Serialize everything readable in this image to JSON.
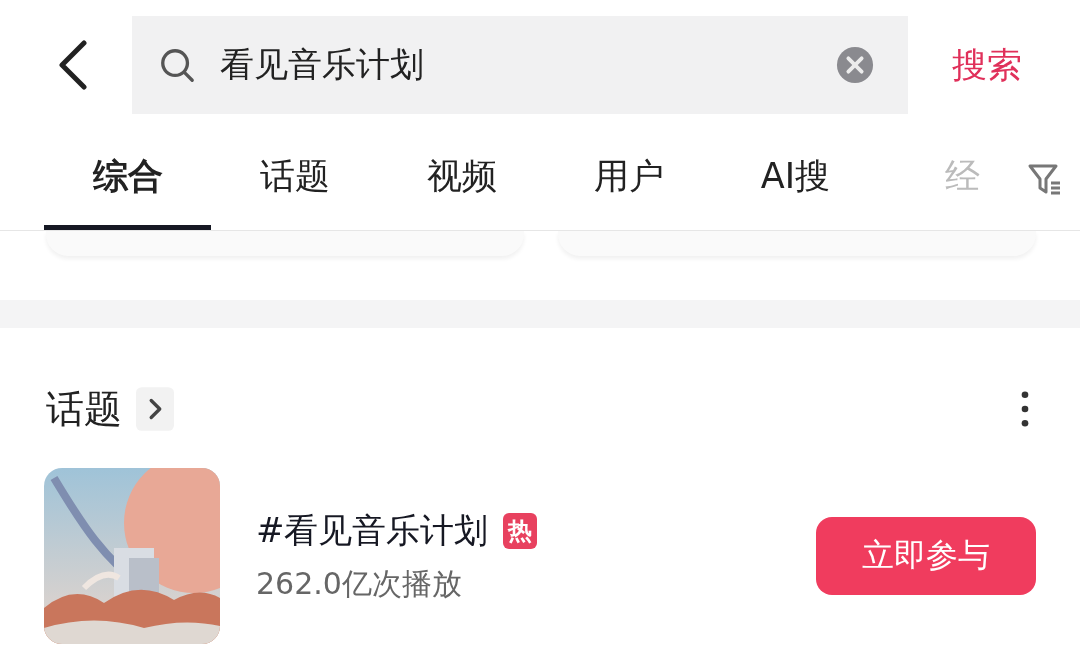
{
  "search": {
    "value": "看见音乐计划",
    "button": "搜索"
  },
  "tabs": [
    {
      "label": "综合",
      "selected": true
    },
    {
      "label": "话题",
      "selected": false
    },
    {
      "label": "视频",
      "selected": false
    },
    {
      "label": "用户",
      "selected": false
    },
    {
      "label": "AI搜",
      "selected": false
    },
    {
      "label": "经",
      "selected": false
    }
  ],
  "section": {
    "title": "话题"
  },
  "topic": {
    "title": "#看见音乐计划",
    "badge": "热",
    "plays": "262.0亿次播放",
    "button": "立即参与"
  }
}
